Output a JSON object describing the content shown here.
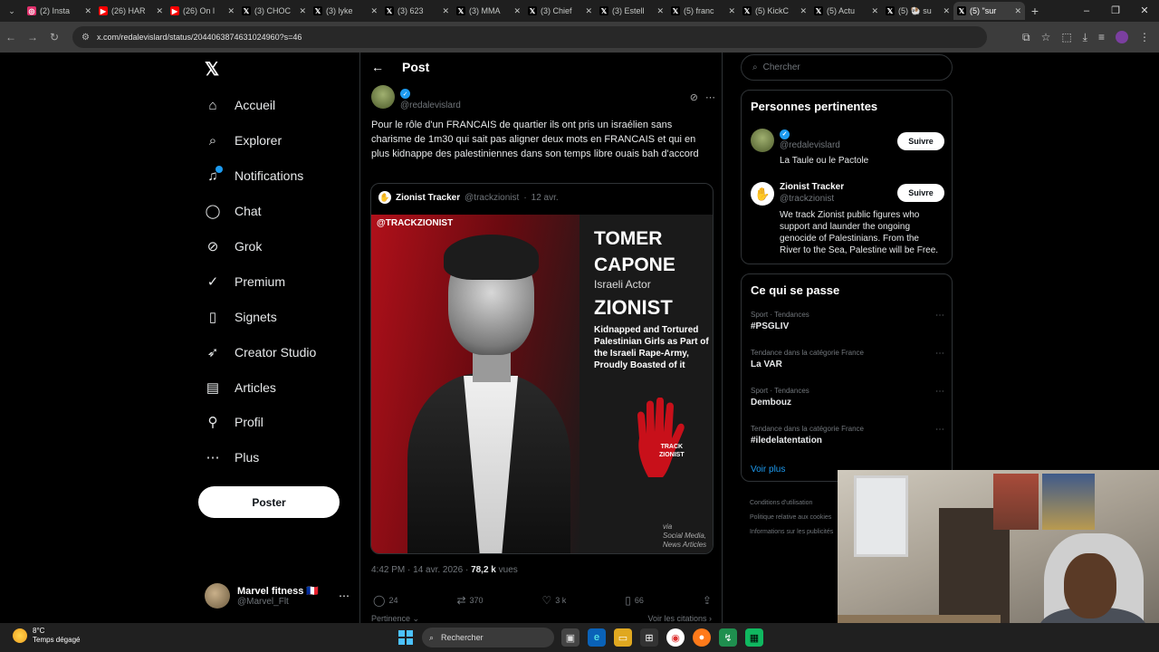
{
  "browser": {
    "tabs": [
      {
        "title": "(2) Insta",
        "icon": "instagram-icon",
        "color": "#e1306c",
        "glyph": "◎"
      },
      {
        "title": "(26) HAR",
        "icon": "youtube-icon",
        "color": "#ff0000",
        "glyph": "▶"
      },
      {
        "title": "(26) On l",
        "icon": "youtube-icon",
        "color": "#ff0000",
        "glyph": "▶"
      },
      {
        "title": "(3) CHOC",
        "icon": "x-icon",
        "color": "#000000",
        "glyph": "𝕏"
      },
      {
        "title": "(3) lyke",
        "icon": "x-icon",
        "color": "#000000",
        "glyph": "𝕏"
      },
      {
        "title": "(3) 623",
        "icon": "x-icon",
        "color": "#000000",
        "glyph": "𝕏"
      },
      {
        "title": "(3) MMA",
        "icon": "x-icon",
        "color": "#000000",
        "glyph": "𝕏"
      },
      {
        "title": "(3) Chief",
        "icon": "x-icon",
        "color": "#000000",
        "glyph": "𝕏"
      },
      {
        "title": "(3) Estell",
        "icon": "x-icon",
        "color": "#000000",
        "glyph": "𝕏"
      },
      {
        "title": "(5) franc",
        "icon": "x-icon",
        "color": "#000000",
        "glyph": "𝕏"
      },
      {
        "title": "(5) KickC",
        "icon": "x-icon",
        "color": "#000000",
        "glyph": "𝕏"
      },
      {
        "title": "(5) Actu",
        "icon": "x-icon",
        "color": "#000000",
        "glyph": "𝕏"
      },
      {
        "title": "(5) 🐏 su",
        "icon": "x-icon",
        "color": "#000000",
        "glyph": "𝕏"
      },
      {
        "title": "(5) \"sur",
        "icon": "x-icon",
        "color": "#000000",
        "glyph": "𝕏",
        "active": true
      }
    ],
    "url": "x.com/redalevislard/status/2044063874631024960?s=46"
  },
  "nav": {
    "logo": "𝕏",
    "items": [
      {
        "label": "Accueil",
        "icon": "home-icon",
        "glyph": "⌂"
      },
      {
        "label": "Explorer",
        "icon": "search-icon",
        "glyph": "⌕"
      },
      {
        "label": "Notifications",
        "icon": "bell-icon",
        "glyph": "♫",
        "badge": true
      },
      {
        "label": "Chat",
        "icon": "chat-icon",
        "glyph": "◯"
      },
      {
        "label": "Grok",
        "icon": "grok-icon",
        "glyph": "⊘"
      },
      {
        "label": "Premium",
        "icon": "premium-icon",
        "glyph": "✓"
      },
      {
        "label": "Signets",
        "icon": "bookmark-icon",
        "glyph": "▯"
      },
      {
        "label": "Creator Studio",
        "icon": "rocket-icon",
        "glyph": "➶"
      },
      {
        "label": "Articles",
        "icon": "article-icon",
        "glyph": "▤"
      },
      {
        "label": "Profil",
        "icon": "profile-icon",
        "glyph": "⚲"
      },
      {
        "label": "Plus",
        "icon": "more-circle-icon",
        "glyph": "⋯"
      }
    ],
    "post_button": "Poster",
    "account": {
      "name": "Marvel fitness 🇫🇷",
      "handle": "@Marvel_Flt"
    }
  },
  "post": {
    "header": "Post",
    "author_handle": "@redalevislard",
    "text": "Pour le rôle d'un FRANCAIS de quartier ils ont pris un israélien sans charisme de 1m30 qui sait pas aligner deux mots en FRANCAIS et qui en plus kidnappe des palestiniennes dans son temps libre ouais bah d'accord",
    "quote": {
      "name": "Zionist Tracker",
      "handle": "@trackzionist",
      "date": "12 avr.",
      "image": {
        "tag": "@TRACKZIONIST",
        "name_line1": "TOMER",
        "name_line2": "CAPONE",
        "role": "Israeli Actor",
        "label": "ZIONIST",
        "description": "Kidnapped and Tortured Palestinian Girls as Part of the Israeli Rape-Army, Proudly Boasted of it",
        "hand_label_1": "TRACK",
        "hand_label_2": "ZIONIST",
        "via_1": "via",
        "via_2": "Social Media,",
        "via_3": "News Articles"
      }
    },
    "time": "4:42 PM · 14 avr. 2026 · ",
    "views_count": "78,2 k",
    "views_label": " vues",
    "actions": {
      "replies": "24",
      "reposts": "370",
      "likes": "3 k",
      "bookmarks": "66"
    },
    "relevance": "Pertinence ⌄",
    "view_quotes": "Voir les citations ›"
  },
  "sidebar": {
    "search_placeholder": "Chercher",
    "relevant_title": "Personnes pertinentes",
    "people": [
      {
        "name": "",
        "handle": "@redalevislard",
        "bio": "La Taule ou le Pactole",
        "follow": "Suivre",
        "verified": true
      },
      {
        "name": "Zionist Tracker",
        "handle": "@trackzionist",
        "bio": "We track Zionist public figures who support and launder the ongoing genocide of Palestinians. From the River to the Sea, Palestine will be Free.",
        "follow": "Suivre"
      }
    ],
    "trends_title": "Ce qui se passe",
    "trends": [
      {
        "category": "Sport · Tendances",
        "name": "#PSGLIV"
      },
      {
        "category": "Tendance dans la catégorie France",
        "name": "La VAR"
      },
      {
        "category": "Sport · Tendances",
        "name": "Dembouz"
      },
      {
        "category": "Tendance dans la catégorie France",
        "name": "#iledelatentation"
      }
    ],
    "show_more": "Voir plus",
    "footer": [
      "Conditions d'utilisation",
      "Politique relative aux cookies",
      "Informations sur les publicités"
    ]
  },
  "taskbar": {
    "temp": "8°C",
    "weather": "Temps dégagé",
    "search": "Rechercher"
  }
}
